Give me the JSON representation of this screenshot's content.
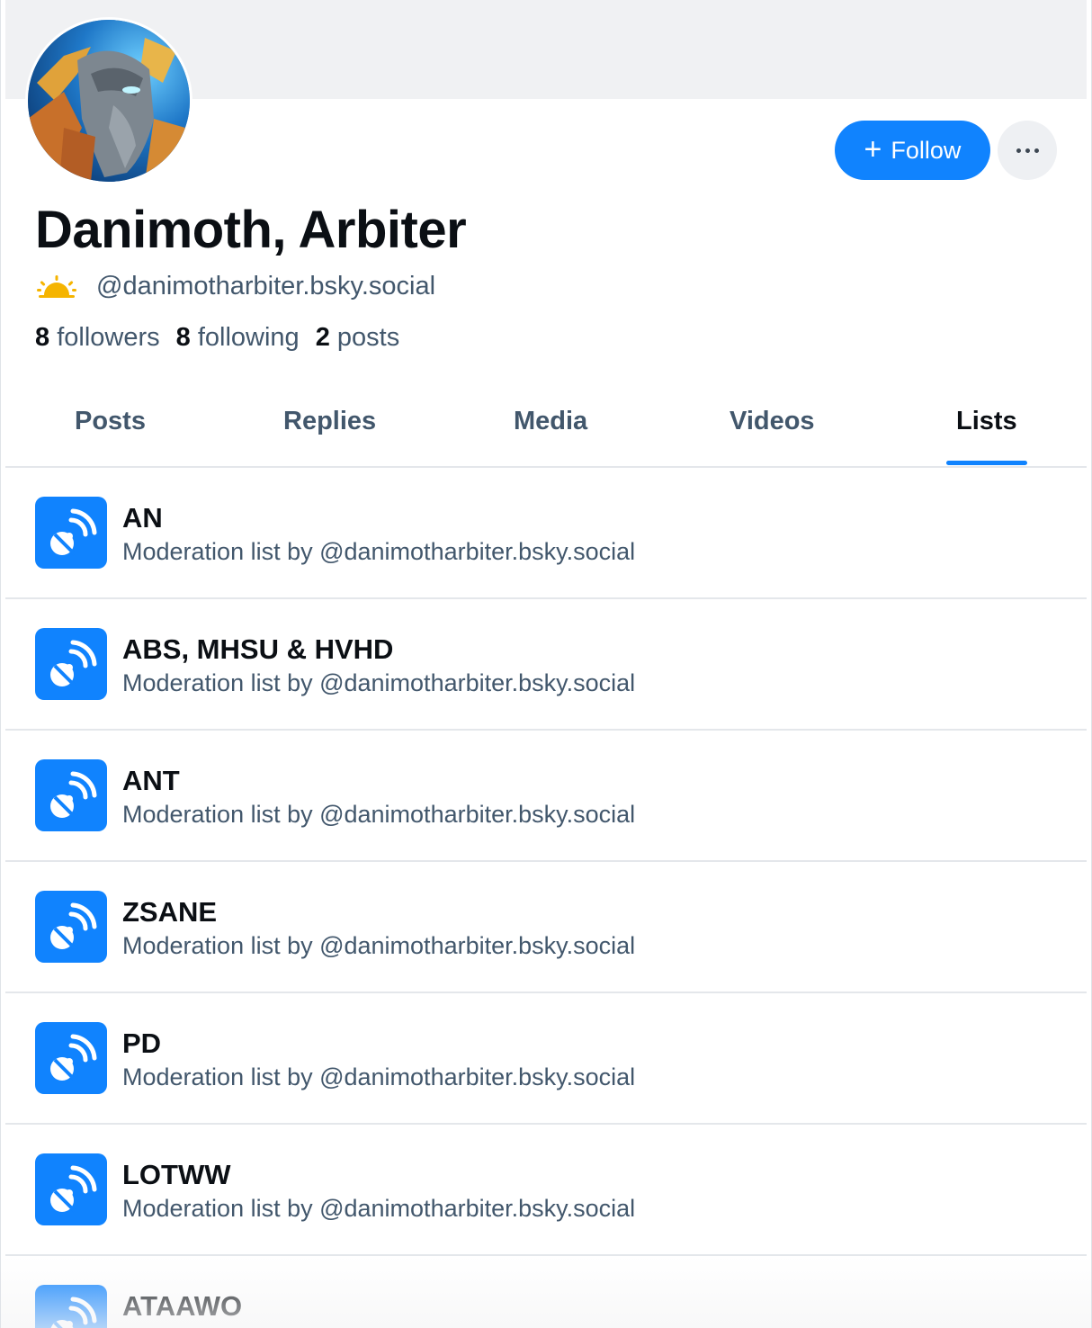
{
  "profile": {
    "display_name": "Danimoth, Arbiter",
    "handle": "@danimotharbiter.bsky.social",
    "status_icon": "sunrise-icon",
    "stats": {
      "followers_count": "8",
      "followers_label": "followers",
      "following_count": "8",
      "following_label": "following",
      "posts_count": "2",
      "posts_label": "posts"
    }
  },
  "actions": {
    "follow_label": "Follow",
    "follow_icon": "plus-icon",
    "more_icon": "ellipsis-icon"
  },
  "tabs": [
    {
      "label": "Posts",
      "active": false
    },
    {
      "label": "Replies",
      "active": false
    },
    {
      "label": "Media",
      "active": false
    },
    {
      "label": "Videos",
      "active": false
    },
    {
      "label": "Lists",
      "active": true
    }
  ],
  "lists": [
    {
      "title": "AN",
      "subtitle": "Moderation list by @danimotharbiter.bsky.social"
    },
    {
      "title": "ABS, MHSU & HVHD",
      "subtitle": "Moderation list by @danimotharbiter.bsky.social"
    },
    {
      "title": "ANT",
      "subtitle": "Moderation list by @danimotharbiter.bsky.social"
    },
    {
      "title": "ZSANE",
      "subtitle": "Moderation list by @danimotharbiter.bsky.social"
    },
    {
      "title": "PD",
      "subtitle": "Moderation list by @danimotharbiter.bsky.social"
    },
    {
      "title": "LOTWW",
      "subtitle": "Moderation list by @danimotharbiter.bsky.social"
    },
    {
      "title": "ATAAWO",
      "subtitle": ""
    }
  ],
  "colors": {
    "accent": "#1083fe",
    "text_primary": "#0b0f14",
    "text_secondary": "#42576c",
    "banner": "#f0f1f3",
    "divider": "#e4e7eb",
    "status_icon": "#f5b400"
  }
}
